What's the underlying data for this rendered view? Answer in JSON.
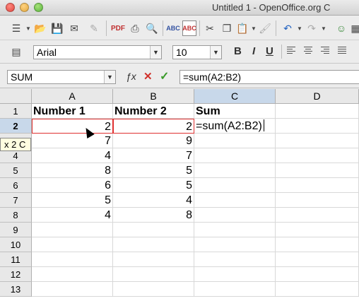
{
  "window": {
    "title": "Untitled 1 - OpenOffice.org C"
  },
  "font": {
    "name": "Arial",
    "size": "10"
  },
  "formula": {
    "name_box": "SUM",
    "input": "=sum(A2:B2)"
  },
  "toolbar1_icons": [
    "menu-list-icon",
    "new-doc-icon",
    "open-folder-icon",
    "save-icon",
    "email-icon",
    "edit-icon",
    "pdf-icon",
    "print-icon",
    "preview-icon",
    "spellcheck-icon",
    "auto-spellcheck-icon",
    "cut-icon",
    "copy-icon",
    "paste-icon",
    "clone-format-icon",
    "undo-icon",
    "redo-icon",
    "navigator-icon"
  ],
  "format_buttons": {
    "bold": "B",
    "italic": "I",
    "underline": "U"
  },
  "sheet": {
    "columns": [
      "A",
      "B",
      "C",
      "D"
    ],
    "rows": [
      "1",
      "2",
      "3",
      "4",
      "5",
      "6",
      "7",
      "8",
      "9",
      "10",
      "11",
      "12",
      "13"
    ],
    "active_column": "C",
    "active_row": "2",
    "headers": [
      "Number 1",
      "Number 2",
      "Sum"
    ],
    "data": [
      [
        "2",
        "2",
        "=sum(A2:B2)"
      ],
      [
        "7",
        "9",
        ""
      ],
      [
        "4",
        "7",
        ""
      ],
      [
        "8",
        "5",
        ""
      ],
      [
        "6",
        "5",
        ""
      ],
      [
        "5",
        "4",
        ""
      ],
      [
        "4",
        "8",
        ""
      ]
    ]
  },
  "tooltip": "x 2 C",
  "colors": {
    "ref_border": "#e03030",
    "active_header": "#c8d8ea"
  }
}
